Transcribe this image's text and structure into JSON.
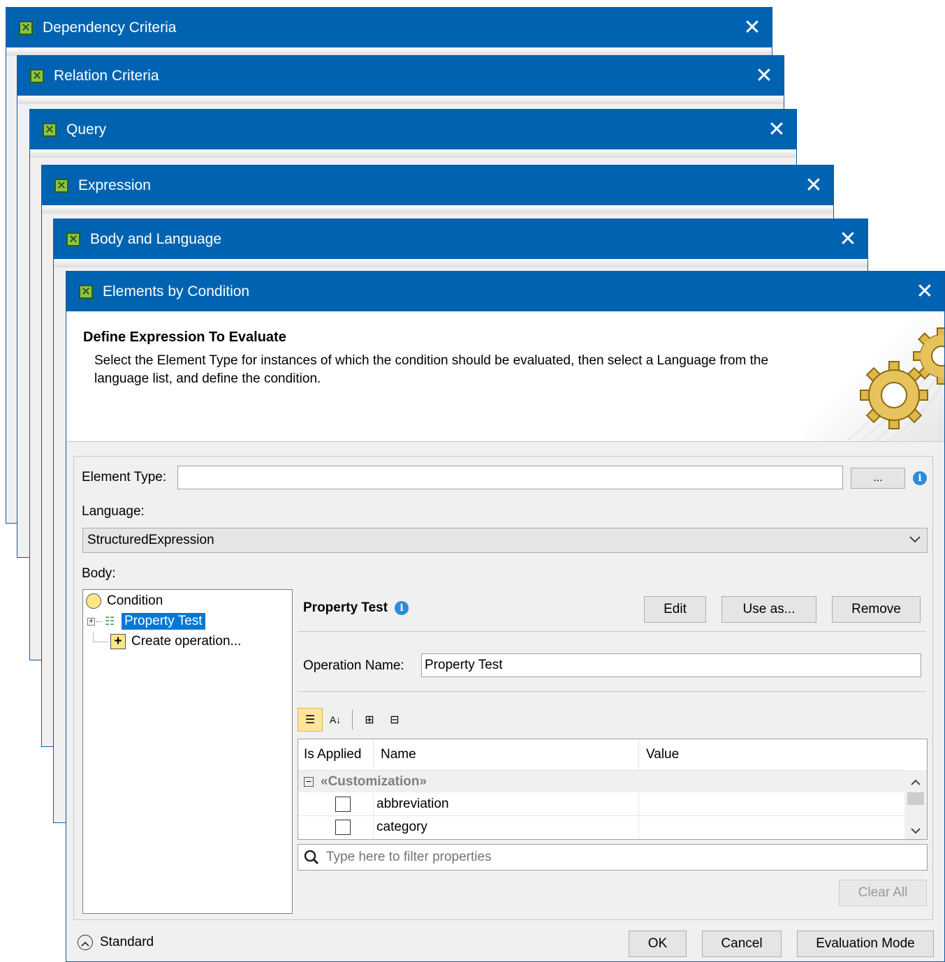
{
  "windows": [
    {
      "title": "Dependency Criteria"
    },
    {
      "title": "Relation Criteria"
    },
    {
      "title": "Query"
    },
    {
      "title": "Expression"
    },
    {
      "title": "Body and Language"
    },
    {
      "title": "Elements by Condition"
    }
  ],
  "header": {
    "title": "Define Expression To Evaluate",
    "description": "Select the Element Type for instances of which the condition should be evaluated, then select a Language from the language list, and define the condition."
  },
  "form": {
    "element_type_label": "Element Type:",
    "element_type_value": "",
    "browse_label": "...",
    "language_label": "Language:",
    "language_value": "StructuredExpression",
    "body_label": "Body:"
  },
  "tree": {
    "items": [
      {
        "label": "Condition"
      },
      {
        "label": "Property Test"
      },
      {
        "label": "Create operation..."
      }
    ]
  },
  "details": {
    "title": "Property Test",
    "edit_label": "Edit",
    "use_as_label": "Use as...",
    "remove_label": "Remove",
    "operation_name_label": "Operation Name:",
    "operation_name_value": "Property Test"
  },
  "grid": {
    "columns": [
      "Is Applied",
      "Name",
      "Value"
    ],
    "group": "«Customization»",
    "rows": [
      {
        "name": "abbreviation",
        "value": "",
        "applied": false
      },
      {
        "name": "category",
        "value": "",
        "applied": false
      }
    ]
  },
  "filter": {
    "placeholder": "Type here to filter properties"
  },
  "clear_all_label": "Clear All",
  "footer": {
    "mode_label": "Standard",
    "ok_label": "OK",
    "cancel_label": "Cancel",
    "evaluation_label": "Evaluation Mode"
  },
  "colors": {
    "titlebar": "#0063b1",
    "selection": "#0078d7",
    "group_text": "#7f7f7f"
  }
}
